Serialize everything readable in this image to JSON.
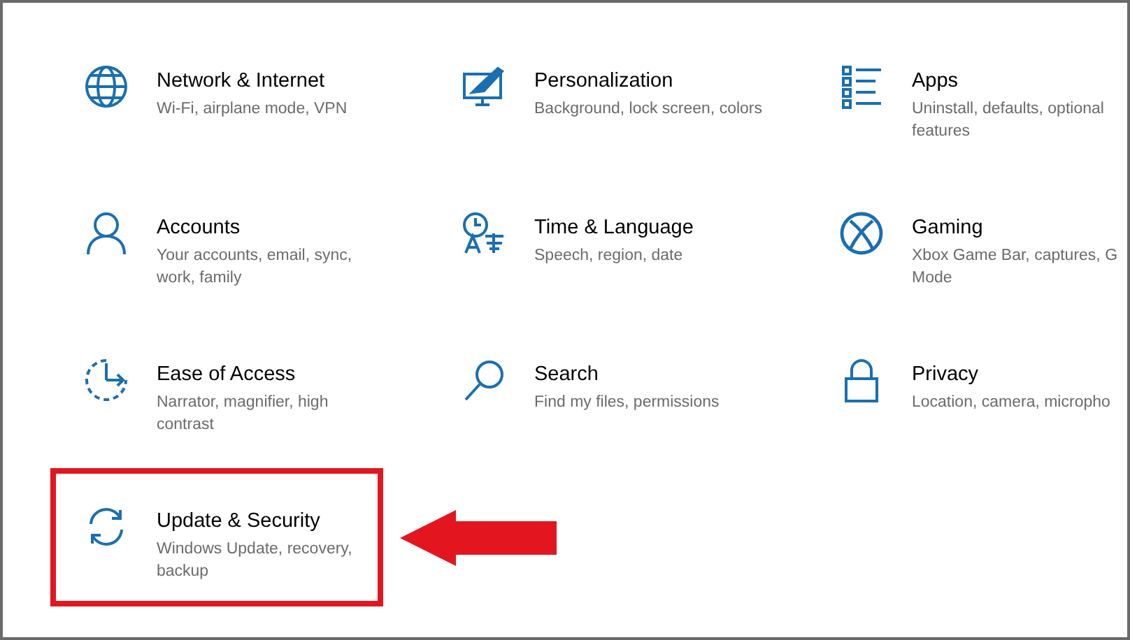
{
  "settings": [
    {
      "title": "Network & Internet",
      "subtitle": "Wi-Fi, airplane mode, VPN",
      "highlighted": false
    },
    {
      "title": "Personalization",
      "subtitle": "Background, lock screen, colors",
      "highlighted": false
    },
    {
      "title": "Apps",
      "subtitle": "Uninstall, defaults, optional features",
      "highlighted": false
    },
    {
      "title": "Accounts",
      "subtitle": "Your accounts, email, sync, work, family",
      "highlighted": false
    },
    {
      "title": "Time & Language",
      "subtitle": "Speech, region, date",
      "highlighted": false
    },
    {
      "title": "Gaming",
      "subtitle": "Xbox Game Bar, captures, G",
      "subtitle_2": "Mode",
      "highlighted": false
    },
    {
      "title": "Ease of Access",
      "subtitle": "Narrator, magnifier, high contrast",
      "highlighted": false
    },
    {
      "title": "Search",
      "subtitle": "Find my files, permissions",
      "highlighted": false
    },
    {
      "title": "Privacy",
      "subtitle": "Location, camera, micropho",
      "highlighted": false
    },
    {
      "title": "Update & Security",
      "subtitle": "Windows Update, recovery, backup",
      "highlighted": true
    }
  ]
}
